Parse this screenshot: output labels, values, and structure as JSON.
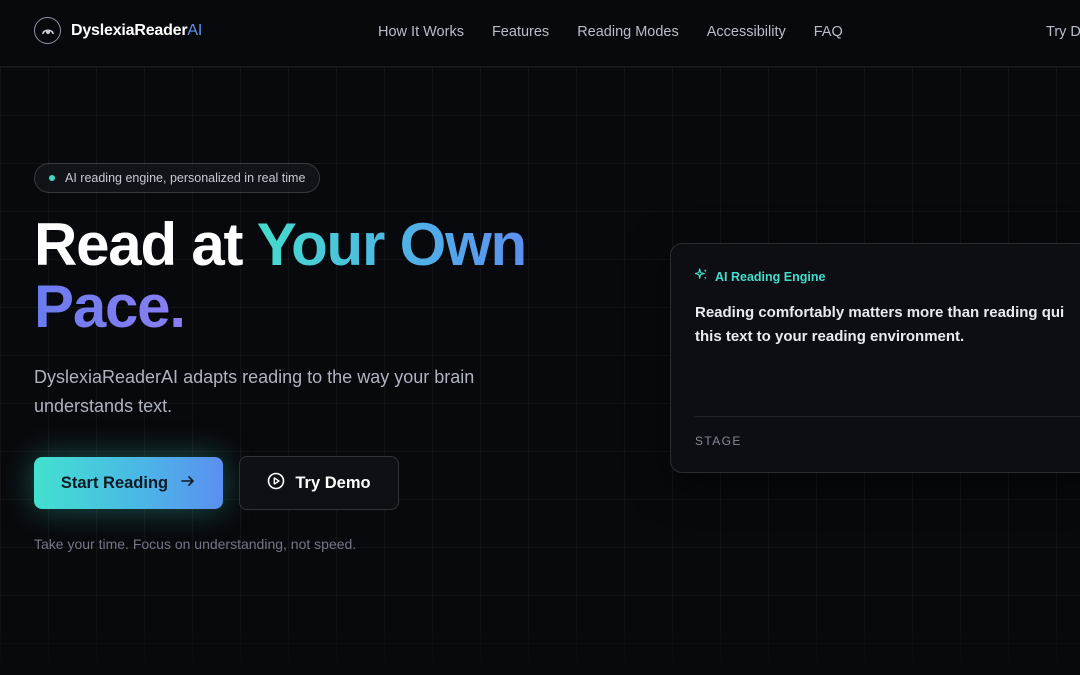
{
  "nav": {
    "logo_main": "DyslexiaReader",
    "logo_accent": "AI",
    "links": [
      "How It Works",
      "Features",
      "Reading Modes",
      "Accessibility",
      "FAQ"
    ],
    "cta": "Try D"
  },
  "hero": {
    "badge": "AI reading engine, personalized in real time",
    "headline_plain": "Read at ",
    "headline_grad1": "Your Own",
    "headline_grad2": "Pace.",
    "subtitle": "DyslexiaReaderAI adapts reading to the way your brain understands text.",
    "primary_button": "Start Reading",
    "secondary_button": "Try Demo",
    "note": "Take your time. Focus on understanding, not speed."
  },
  "engine_card": {
    "title": "AI Reading Engine",
    "line1": "Reading comfortably matters more than reading qui",
    "line2": "this text to your reading environment.",
    "stage_label": "STAGE"
  },
  "colors": {
    "accent_teal": "#45dccb",
    "accent_blue": "#5b8ff0",
    "accent_violet": "#8a7ef2",
    "background": "#08090d"
  },
  "icons": {
    "logo": "brain-eye-icon",
    "primary_button": "arrow-right-icon",
    "secondary_button": "play-circle-icon",
    "card_header": "sparkles-icon",
    "badge": "status-dot-icon"
  }
}
